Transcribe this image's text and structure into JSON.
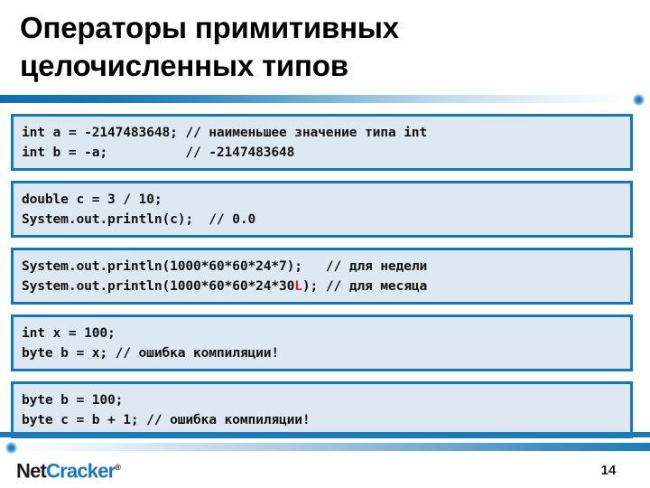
{
  "slide": {
    "title_lines": [
      "Операторы примитивных",
      "целочисленных типов"
    ],
    "page_number": "14"
  },
  "theme": {
    "accent_blue": "#1379be",
    "bar_blue": "#1a7cbb",
    "code_bg": "#dde8f1",
    "code_text": "#141414",
    "highlight_red": "#e01b24",
    "logo_dark": "#1d1d1d",
    "logo_blue": "#1778c2"
  },
  "code_boxes": [
    {
      "id": "box1",
      "line1": "int a = -2147483648; // наименьшее значение типа int",
      "line2": "int b = -a;          // -2147483648"
    },
    {
      "id": "box2",
      "line1": "double c = 3 / 10;",
      "line2": "System.out.println(c);  // 0.0"
    },
    {
      "id": "box3",
      "line1": "System.out.println(1000*60*60*24*7);   // для недели",
      "line2_pre": "System.out.println(1000*60*60*24*30",
      "line2_hl": "L",
      "line2_post": "); // для месяца"
    },
    {
      "id": "box4",
      "line1": "int x = 100;",
      "line2": "byte b = x; // ошибка компиляции!"
    },
    {
      "id": "box5",
      "line1": "byte b = 100;",
      "line2": "byte c = b + 1; // ошибка компиляции!"
    }
  ],
  "footer": {
    "logo_part1": "Net",
    "logo_part2": "Cracker",
    "logo_registered": "®"
  }
}
